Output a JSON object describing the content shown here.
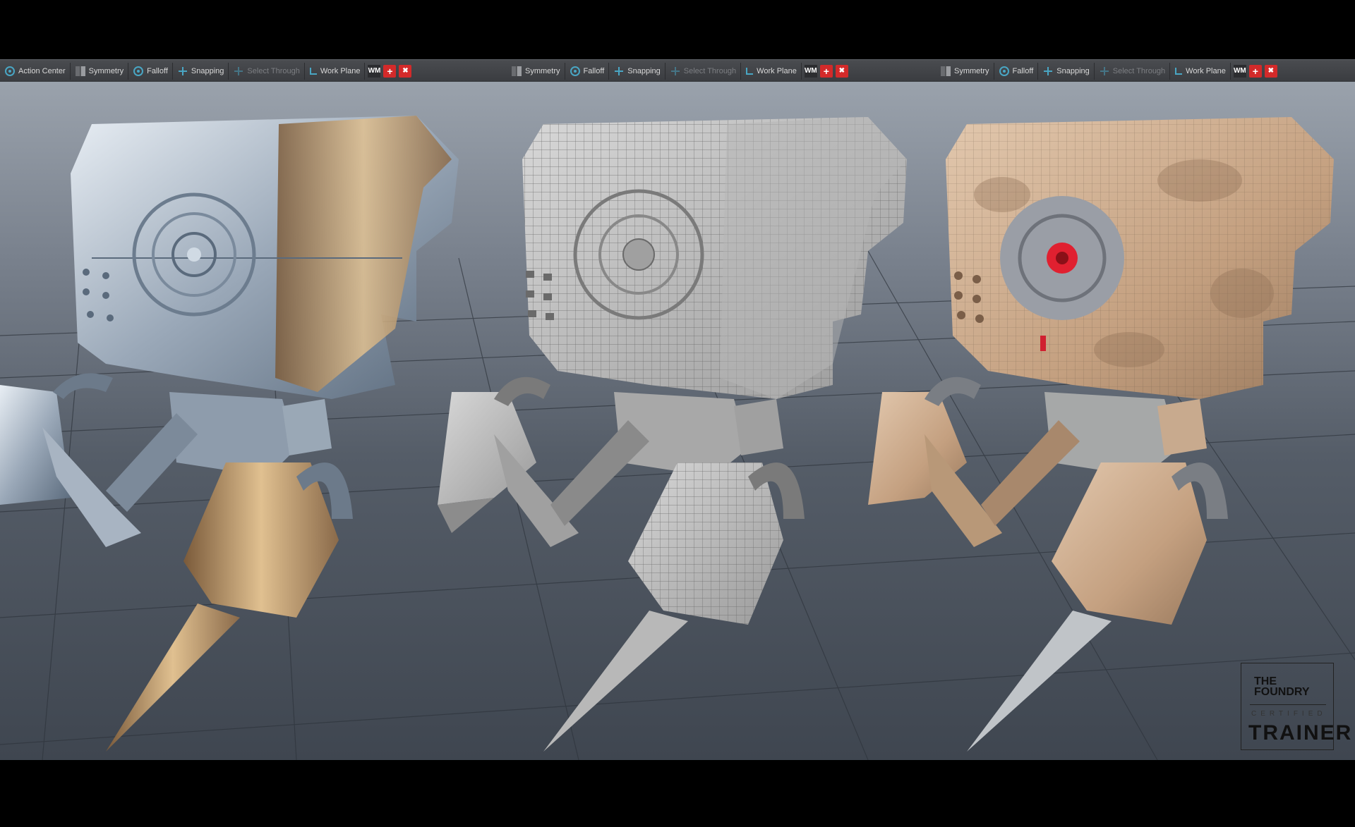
{
  "toolbar_groups": [
    {
      "items": [
        {
          "label": "Action Center",
          "icon": "target-icon",
          "disabled": false
        },
        {
          "label": "Symmetry",
          "icon": "symmetry-icon",
          "disabled": false
        },
        {
          "label": "Falloff",
          "icon": "target-icon",
          "disabled": false
        },
        {
          "label": "Snapping",
          "icon": "crosshair-icon",
          "disabled": false
        },
        {
          "label": "Select Through",
          "icon": "crosshair-icon",
          "disabled": true
        },
        {
          "label": "Work Plane",
          "icon": "workplane-icon",
          "disabled": false
        }
      ],
      "wm": "WM"
    },
    {
      "items": [
        {
          "label": "Symmetry",
          "icon": "symmetry-icon",
          "disabled": false
        },
        {
          "label": "Falloff",
          "icon": "target-icon",
          "disabled": false
        },
        {
          "label": "Snapping",
          "icon": "crosshair-icon",
          "disabled": false
        },
        {
          "label": "Select Through",
          "icon": "crosshair-icon",
          "disabled": true
        },
        {
          "label": "Work Plane",
          "icon": "workplane-icon",
          "disabled": false
        }
      ],
      "wm": "WM"
    },
    {
      "items": [
        {
          "label": "Symmetry",
          "icon": "symmetry-icon",
          "disabled": false
        },
        {
          "label": "Falloff",
          "icon": "target-icon",
          "disabled": false
        },
        {
          "label": "Snapping",
          "icon": "crosshair-icon",
          "disabled": false
        },
        {
          "label": "Select Through",
          "icon": "crosshair-icon",
          "disabled": true
        },
        {
          "label": "Work Plane",
          "icon": "workplane-icon",
          "disabled": false
        }
      ],
      "wm": "WM"
    }
  ],
  "logo": {
    "line1": "THE",
    "line2": "FOUNDRY",
    "line3": "CERTIFIED",
    "line4": "TRAINER"
  },
  "colors": {
    "accent": "#49a6c4",
    "red": "#d32a2a",
    "metal": "#c8d2dc",
    "wire": "#b8b8b8",
    "rust": "#c9a88a"
  }
}
